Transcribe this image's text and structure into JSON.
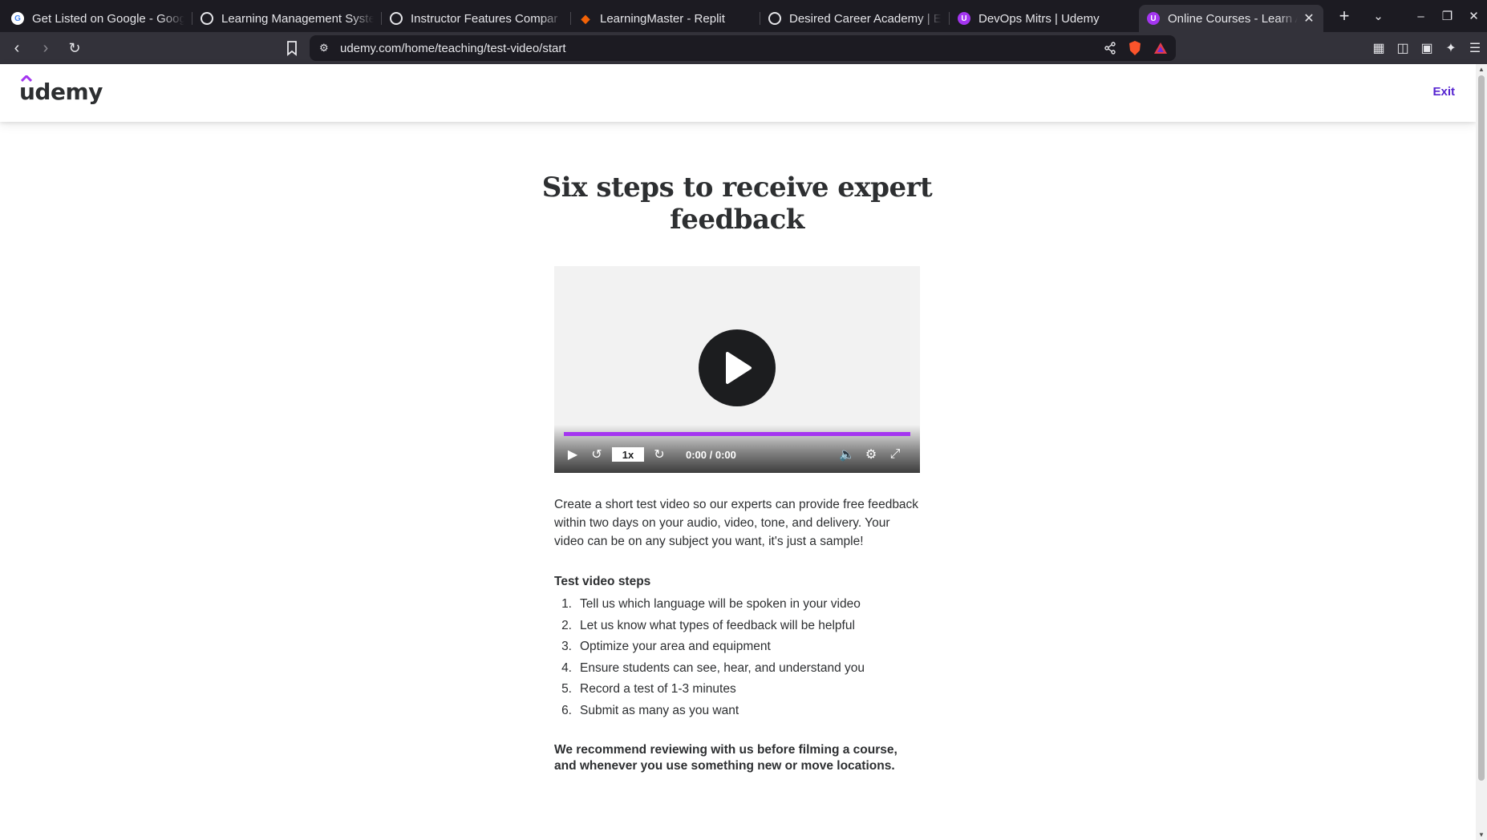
{
  "browser": {
    "tabs": [
      {
        "title": "Get Listed on Google - Goog",
        "favicon": "google-g-icon",
        "active": false
      },
      {
        "title": "Learning Management Syste",
        "favicon": "openai-icon",
        "active": false
      },
      {
        "title": "Instructor Features Compar",
        "favicon": "openai-icon",
        "active": false
      },
      {
        "title": "LearningMaster - Replit",
        "favicon": "replit-icon",
        "active": false
      },
      {
        "title": "Desired Career Academy | E",
        "favicon": "globe-icon",
        "active": false
      },
      {
        "title": "DevOps Mitrs | Udemy",
        "favicon": "udemy-icon",
        "active": false
      },
      {
        "title": "Online Courses - Learn A",
        "favicon": "udemy-icon",
        "active": true
      }
    ],
    "url": "udemy.com/home/teaching/test-video/start",
    "colors": {
      "chrome_dark": "#1c1b22",
      "chrome_toolbar": "#33323a"
    }
  },
  "header": {
    "logo_text": "udemy",
    "exit_label": "Exit",
    "accent": "#5624d0"
  },
  "main": {
    "title": "Six steps to receive expert feedback",
    "video": {
      "rate": "1x",
      "time": "0:00 / 0:00",
      "progress_color": "#a435f0"
    },
    "description": "Create a short test video so our experts can provide free feedback within two days on your audio, video, tone, and delivery. Your video can be on any subject you want, it's just a sample!",
    "steps_title": "Test video steps",
    "steps": [
      {
        "num": "1.",
        "text": "Tell us which language will be spoken in your video"
      },
      {
        "num": "2.",
        "text": "Let us know what types of feedback will be helpful"
      },
      {
        "num": "3.",
        "text": "Optimize your area and equipment"
      },
      {
        "num": "4.",
        "text": "Ensure students can see, hear, and understand you"
      },
      {
        "num": "5.",
        "text": "Record a test of 1-3 minutes"
      },
      {
        "num": "6.",
        "text": "Submit as many as you want"
      }
    ],
    "recommend": "We recommend reviewing with us before filming a course, and whenever you use something new or move locations."
  }
}
